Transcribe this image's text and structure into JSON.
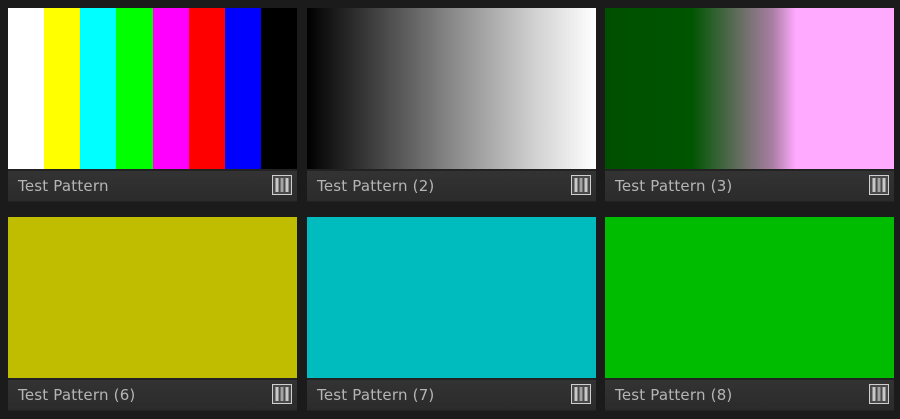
{
  "tiles": [
    {
      "label": "Test Pattern",
      "preview": "color-bars",
      "bar_colors": [
        "#ffffff",
        "#ffff00",
        "#00ffff",
        "#00ff00",
        "#ff00ff",
        "#ff0000",
        "#0000ff",
        "#000000"
      ],
      "icon": "film-strip-icon"
    },
    {
      "label": "Test Pattern (2)",
      "preview": "gray-gradient",
      "gradient_colors": [
        "#000000",
        "#ffffff"
      ],
      "icon": "film-strip-icon"
    },
    {
      "label": "Test Pattern (3)",
      "preview": "green-pink-gradient",
      "gradient_colors": [
        "#005500",
        "#ffa9ff"
      ],
      "icon": "film-strip-icon"
    },
    {
      "label": "Test Pattern (6)",
      "preview": "solid",
      "color": "#c0bd00",
      "icon": "film-strip-icon"
    },
    {
      "label": "Test Pattern (7)",
      "preview": "solid",
      "color": "#00bcbf",
      "icon": "film-strip-icon"
    },
    {
      "label": "Test Pattern (8)",
      "preview": "solid",
      "color": "#00bc00",
      "icon": "film-strip-icon"
    }
  ]
}
